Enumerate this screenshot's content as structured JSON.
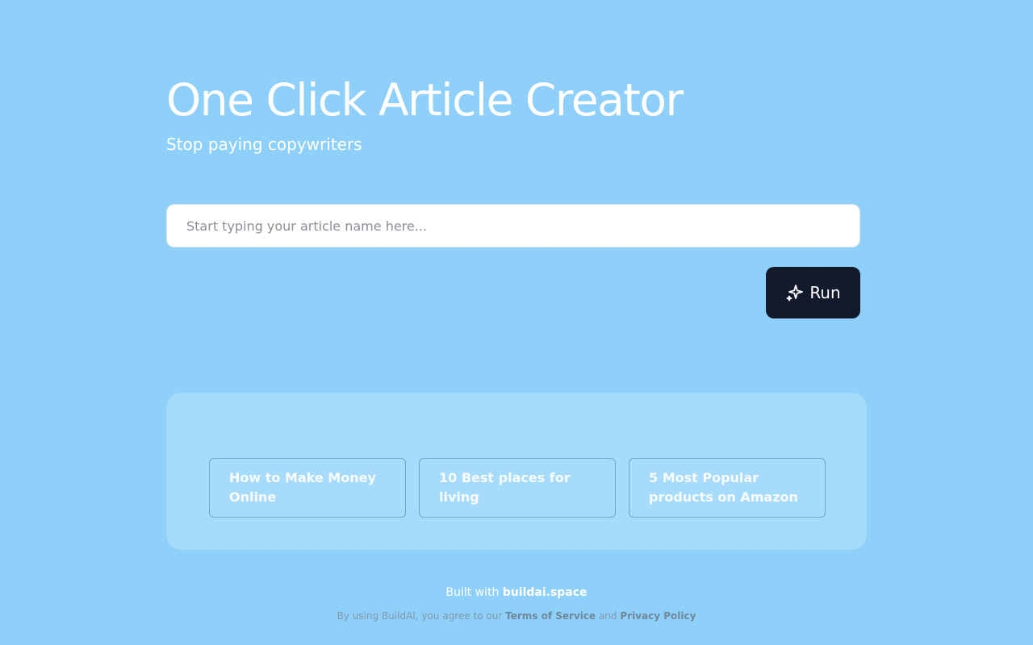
{
  "header": {
    "title": "One Click Article Creator",
    "subtitle": "Stop paying copywriters"
  },
  "input": {
    "value": "",
    "placeholder": "Start typing your article name here..."
  },
  "run_button": {
    "label": "Run",
    "icon": "sparkles-icon"
  },
  "examples": [
    {
      "label": "How to Make Money Online"
    },
    {
      "label": "10 Best places for living"
    },
    {
      "label": "5 Most Popular products on Amazon"
    }
  ],
  "footer": {
    "built_prefix": "Built with",
    "built_link": "buildai.space",
    "legal_prefix": "By using BuildAI, you agree to our",
    "terms_link": "Terms of Service",
    "legal_and": "and",
    "privacy_link": "Privacy Policy"
  },
  "colors": {
    "background": "#8fd0fb",
    "panel": "#a7dbfb",
    "button": "#121a2b",
    "text": "#ffffff"
  }
}
